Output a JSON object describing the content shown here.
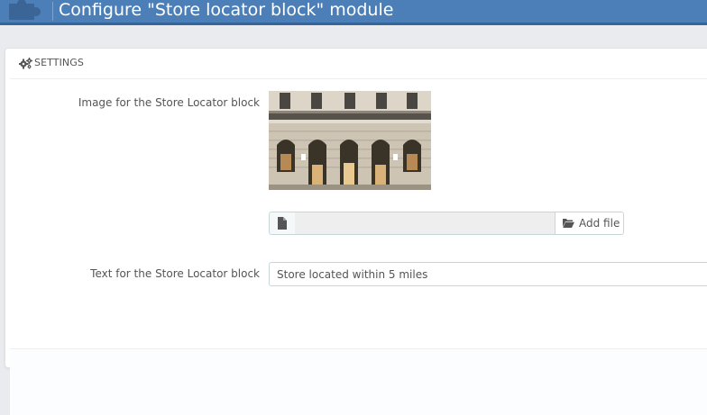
{
  "header": {
    "title": "Configure \"Store locator block\" module",
    "icon": "puzzle-piece-icon"
  },
  "panel": {
    "heading": "SETTINGS",
    "heading_icon": "cogs-icon"
  },
  "form": {
    "image_field": {
      "label": "Image for the Store Locator block",
      "file_name": "",
      "file_icon": "file-icon",
      "add_file_label": "Add file",
      "add_file_icon": "folder-open-icon"
    },
    "text_field": {
      "label": "Text for the Store Locator block",
      "value": "Store located within 5 miles"
    }
  },
  "colors": {
    "header_bg": "#4c7fb7",
    "header_border": "#36659a",
    "page_bg": "#e9ebef",
    "panel_bg": "#ffffff",
    "input_border": "#c7d6db"
  }
}
